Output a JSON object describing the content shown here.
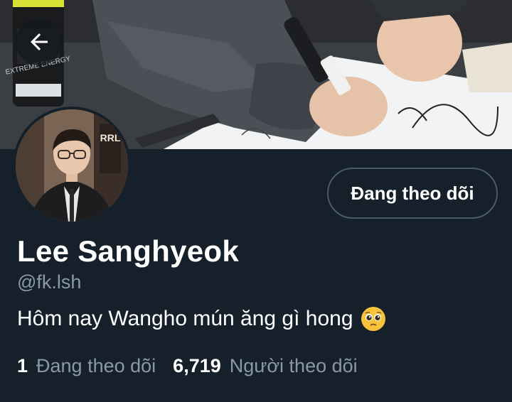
{
  "header": {
    "back_label": "Back"
  },
  "banner": {
    "can_label": "EXTREME ENERGY",
    "note_text": "RRL"
  },
  "profile": {
    "follow_button_label": "Đang theo dõi",
    "display_name": "Lee Sanghyeok",
    "handle": "@fk.lsh",
    "bio": "Hôm nay Wangho mún ăng gì hong",
    "bio_emoji": "pleading-face"
  },
  "stats": {
    "following_count": "1",
    "following_label": "Đang theo dõi",
    "followers_count": "6,719",
    "followers_label": "Người theo dõi"
  },
  "colors": {
    "background": "#15202b",
    "muted_text": "#8b98a5",
    "button_border": "#4a5a6b"
  }
}
